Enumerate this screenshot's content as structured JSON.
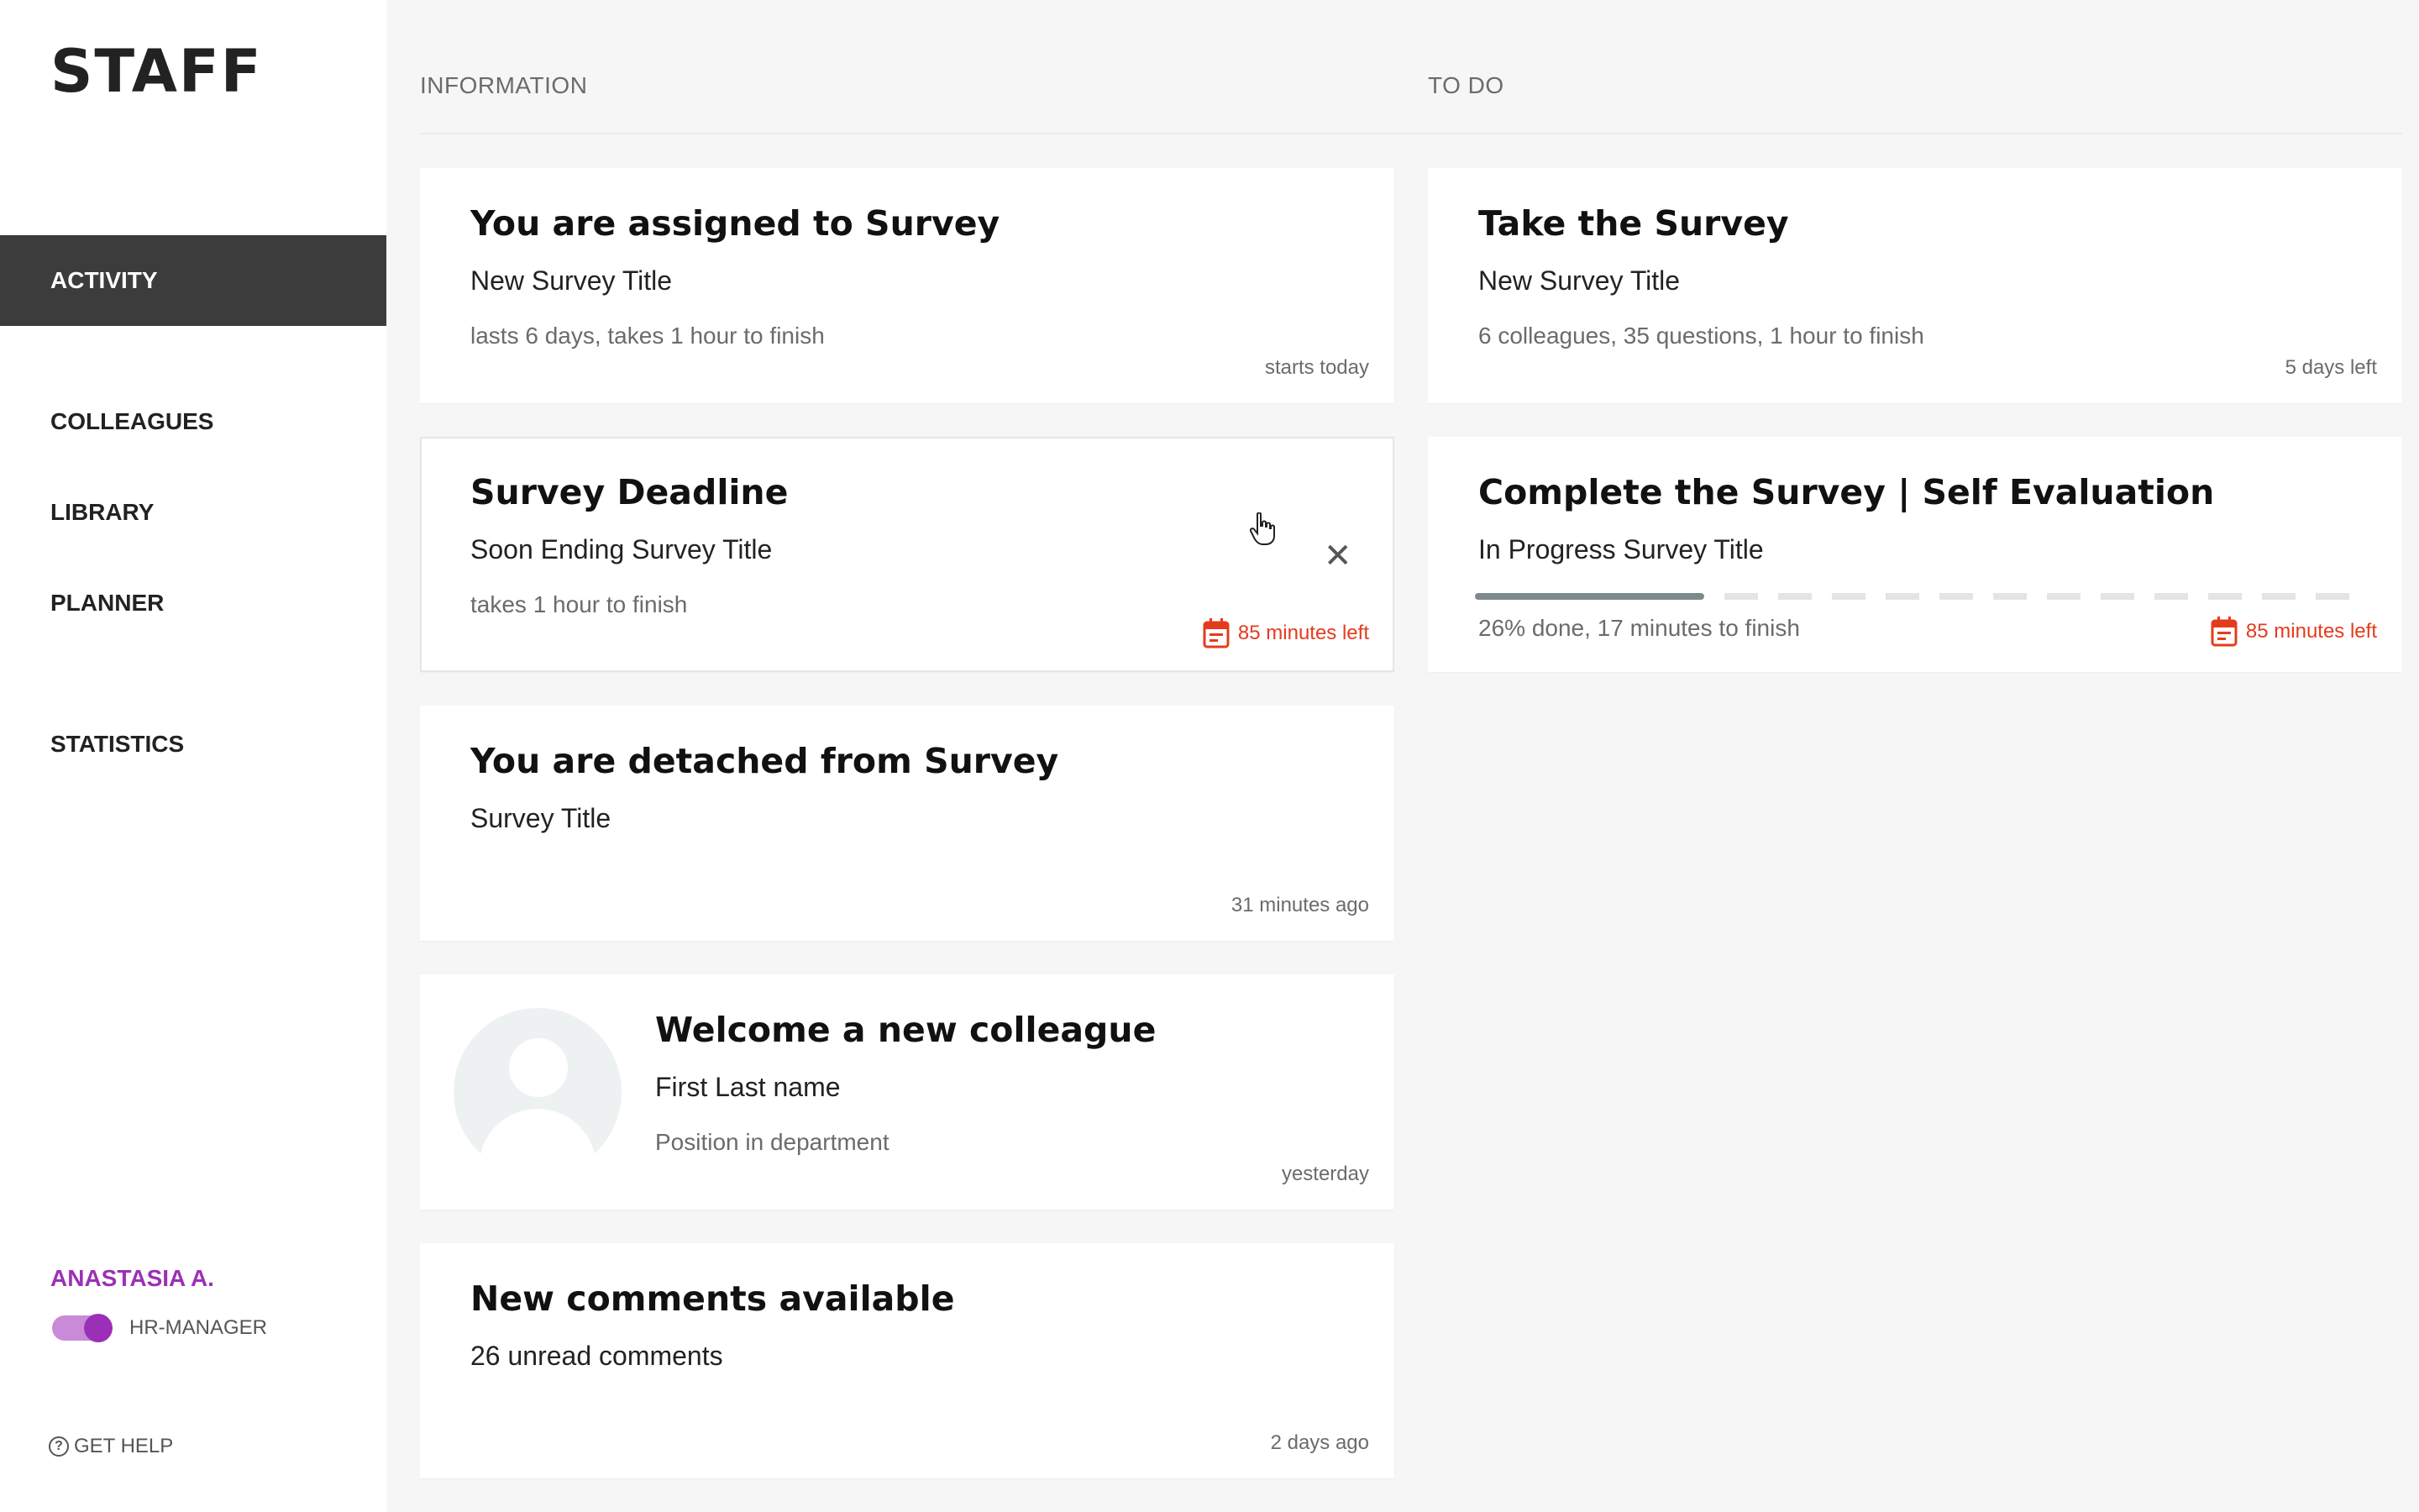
{
  "app": {
    "logo": "STAFF"
  },
  "sidebar": {
    "items": [
      {
        "label": "ACTIVITY",
        "active": true
      },
      {
        "label": "COLLEAGUES"
      },
      {
        "label": "LIBRARY"
      },
      {
        "label": "PLANNER"
      },
      {
        "label": "STATISTICS"
      }
    ],
    "user": {
      "name": "ANASTASIA A.",
      "role": "HR-MANAGER",
      "role_toggle_on": true
    },
    "help_label": "GET HELP"
  },
  "columns": {
    "information": "INFORMATION",
    "todo": "TO DO"
  },
  "info_cards": [
    {
      "title": "You are assigned to Survey",
      "subtitle": "New Survey Title",
      "description": "lasts 6 days, takes 1 hour to finish",
      "meta": "starts today"
    },
    {
      "title": "Survey Deadline",
      "subtitle": "Soon Ending Survey Title",
      "description": "takes 1 hour to finish",
      "meta": "85 minutes left",
      "close_icon": "close-icon"
    },
    {
      "title": "You are detached from Survey",
      "subtitle": "Survey Title",
      "meta": "31 minutes ago"
    },
    {
      "title": "Welcome a new colleague",
      "subtitle": "First Last name",
      "description": "Position in department",
      "meta": "yesterday"
    },
    {
      "title": "New comments available",
      "subtitle": "26 unread comments",
      "meta": "2 days ago"
    }
  ],
  "todo_cards": [
    {
      "title": "Take the Survey",
      "subtitle": "New Survey Title",
      "description": "6 colleagues, 35 questions, 1 hour to finish",
      "meta": "5 days left"
    },
    {
      "title": "Complete the Survey | Self Evaluation",
      "subtitle": "In Progress Survey Title",
      "description": "26% done, 17 minutes to finish",
      "meta": "85 minutes left",
      "progress_percent": 26
    }
  ],
  "colors": {
    "accent": "#9c2fb7",
    "alert": "#e53b1d",
    "active_nav": "#3c3c3c"
  }
}
